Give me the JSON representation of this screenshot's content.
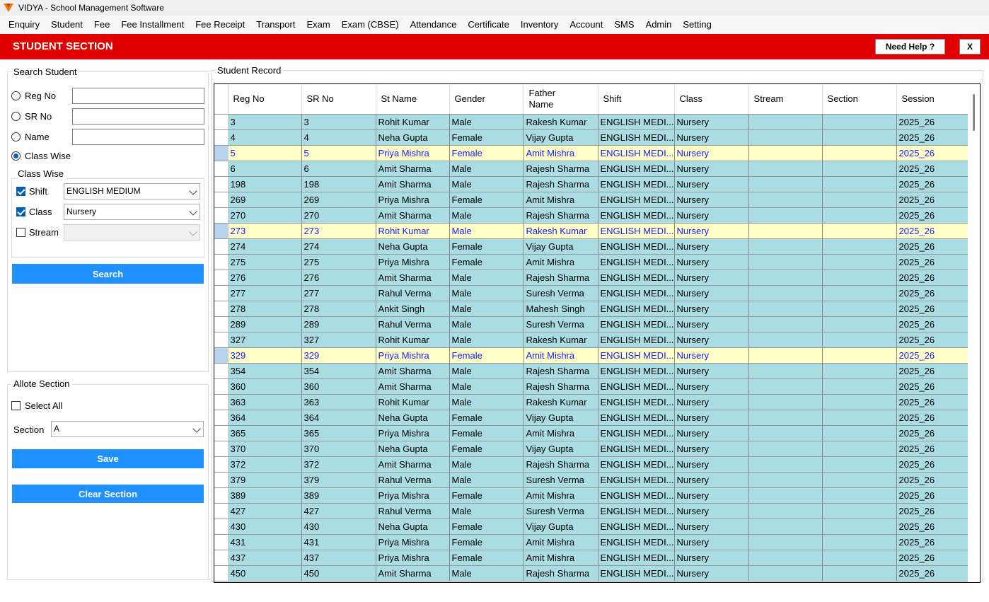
{
  "app": {
    "title": "VIDYA - School Management Software"
  },
  "menu": [
    "Enquiry",
    "Student",
    "Fee",
    "Fee Installment",
    "Fee Receipt",
    "Transport",
    "Exam",
    "Exam (CBSE)",
    "Attendance",
    "Certificate",
    "Inventory",
    "Account",
    "SMS",
    "Admin",
    "Setting"
  ],
  "header": {
    "title": "STUDENT SECTION",
    "help_label": "Need Help ?",
    "close_label": "X",
    "bar_color": "#e00000"
  },
  "search": {
    "group_label": "Search Student",
    "reg_no_label": "Reg No",
    "sr_no_label": "SR No",
    "name_label": "Name",
    "class_wise_label": "Class Wise",
    "selected_mode": "Class Wise",
    "class_wise_group_label": "Class Wise",
    "shift_label": "Shift",
    "shift_value": "ENGLISH MEDIUM",
    "shift_checked": true,
    "class_label": "Class",
    "class_value": "Nursery",
    "class_checked": true,
    "stream_label": "Stream",
    "stream_value": "",
    "stream_checked": false,
    "search_button": "Search"
  },
  "allot": {
    "group_label": "Allote Section",
    "select_all_label": "Select All",
    "section_label": "Section",
    "section_value": "A",
    "save_button": "Save",
    "clear_button": "Clear Section"
  },
  "record": {
    "group_label": "Student Record",
    "columns": [
      "Reg No",
      "SR No",
      "St Name",
      "Gender",
      "Father Name",
      "Shift",
      "Class",
      "Stream",
      "Section",
      "Session"
    ],
    "rows": [
      [
        "3",
        "3",
        "Rohit Kumar",
        "Male",
        "Rakesh Kumar",
        "ENGLISH MEDI...",
        "Nursery",
        "",
        "",
        "2025_26"
      ],
      [
        "4",
        "4",
        "Neha Gupta",
        "Female",
        "Vijay Gupta",
        "ENGLISH MEDI...",
        "Nursery",
        "",
        "",
        "2025_26"
      ],
      [
        "5",
        "5",
        "Priya Mishra",
        "Female",
        "Amit Mishra",
        "ENGLISH MEDI...",
        "Nursery",
        "",
        "",
        "2025_26"
      ],
      [
        "6",
        "6",
        "Amit Sharma",
        "Male",
        "Rajesh Sharma",
        "ENGLISH MEDI...",
        "Nursery",
        "",
        "",
        "2025_26"
      ],
      [
        "198",
        "198",
        "Amit Sharma",
        "Male",
        "Rajesh Sharma",
        "ENGLISH MEDI...",
        "Nursery",
        "",
        "",
        "2025_26"
      ],
      [
        "269",
        "269",
        "Priya Mishra",
        "Female",
        "Amit Mishra",
        "ENGLISH MEDI...",
        "Nursery",
        "",
        "",
        "2025_26"
      ],
      [
        "270",
        "270",
        "Amit Sharma",
        "Male",
        "Rajesh Sharma",
        "ENGLISH MEDI...",
        "Nursery",
        "",
        "",
        "2025_26"
      ],
      [
        "273",
        "273",
        "Rohit Kumar",
        "Male",
        "Rakesh Kumar",
        "ENGLISH MEDI...",
        "Nursery",
        "",
        "",
        "2025_26"
      ],
      [
        "274",
        "274",
        "Neha Gupta",
        "Female",
        "Vijay Gupta",
        "ENGLISH MEDI...",
        "Nursery",
        "",
        "",
        "2025_26"
      ],
      [
        "275",
        "275",
        "Priya Mishra",
        "Female",
        "Amit Mishra",
        "ENGLISH MEDI...",
        "Nursery",
        "",
        "",
        "2025_26"
      ],
      [
        "276",
        "276",
        "Amit Sharma",
        "Male",
        "Rajesh Sharma",
        "ENGLISH MEDI...",
        "Nursery",
        "",
        "",
        "2025_26"
      ],
      [
        "277",
        "277",
        "Rahul Verma",
        "Male",
        "Suresh Verma",
        "ENGLISH MEDI...",
        "Nursery",
        "",
        "",
        "2025_26"
      ],
      [
        "278",
        "278",
        "Ankit Singh",
        "Male",
        "Mahesh Singh",
        "ENGLISH MEDI...",
        "Nursery",
        "",
        "",
        "2025_26"
      ],
      [
        "289",
        "289",
        "Rahul Verma",
        "Male",
        "Suresh Verma",
        "ENGLISH MEDI...",
        "Nursery",
        "",
        "",
        "2025_26"
      ],
      [
        "327",
        "327",
        "Rohit Kumar",
        "Male",
        "Rakesh Kumar",
        "ENGLISH MEDI...",
        "Nursery",
        "",
        "",
        "2025_26"
      ],
      [
        "329",
        "329",
        "Priya Mishra",
        "Female",
        "Amit Mishra",
        "ENGLISH MEDI...",
        "Nursery",
        "",
        "",
        "2025_26"
      ],
      [
        "354",
        "354",
        "Amit Sharma",
        "Male",
        "Rajesh Sharma",
        "ENGLISH MEDI...",
        "Nursery",
        "",
        "",
        "2025_26"
      ],
      [
        "360",
        "360",
        "Amit Sharma",
        "Male",
        "Rajesh Sharma",
        "ENGLISH MEDI...",
        "Nursery",
        "",
        "",
        "2025_26"
      ],
      [
        "363",
        "363",
        "Rohit Kumar",
        "Male",
        "Rakesh Kumar",
        "ENGLISH MEDI...",
        "Nursery",
        "",
        "",
        "2025_26"
      ],
      [
        "364",
        "364",
        "Neha Gupta",
        "Female",
        "Vijay Gupta",
        "ENGLISH MEDI...",
        "Nursery",
        "",
        "",
        "2025_26"
      ],
      [
        "365",
        "365",
        "Priya Mishra",
        "Female",
        "Amit Mishra",
        "ENGLISH MEDI...",
        "Nursery",
        "",
        "",
        "2025_26"
      ],
      [
        "370",
        "370",
        "Neha Gupta",
        "Female",
        "Vijay Gupta",
        "ENGLISH MEDI...",
        "Nursery",
        "",
        "",
        "2025_26"
      ],
      [
        "372",
        "372",
        "Amit Sharma",
        "Male",
        "Rajesh Sharma",
        "ENGLISH MEDI...",
        "Nursery",
        "",
        "",
        "2025_26"
      ],
      [
        "379",
        "379",
        "Rahul Verma",
        "Male",
        "Suresh Verma",
        "ENGLISH MEDI...",
        "Nursery",
        "",
        "",
        "2025_26"
      ],
      [
        "389",
        "389",
        "Priya Mishra",
        "Female",
        "Amit Mishra",
        "ENGLISH MEDI...",
        "Nursery",
        "",
        "",
        "2025_26"
      ],
      [
        "427",
        "427",
        "Rahul Verma",
        "Male",
        "Suresh Verma",
        "ENGLISH MEDI...",
        "Nursery",
        "",
        "",
        "2025_26"
      ],
      [
        "430",
        "430",
        "Neha Gupta",
        "Female",
        "Vijay Gupta",
        "ENGLISH MEDI...",
        "Nursery",
        "",
        "",
        "2025_26"
      ],
      [
        "431",
        "431",
        "Priya Mishra",
        "Female",
        "Amit Mishra",
        "ENGLISH MEDI...",
        "Nursery",
        "",
        "",
        "2025_26"
      ],
      [
        "437",
        "437",
        "Priya Mishra",
        "Female",
        "Amit Mishra",
        "ENGLISH MEDI...",
        "Nursery",
        "",
        "",
        "2025_26"
      ],
      [
        "450",
        "450",
        "Amit Sharma",
        "Male",
        "Rajesh Sharma",
        "ENGLISH MEDI...",
        "Nursery",
        "",
        "",
        "2025_26"
      ]
    ],
    "highlighted_rows": [
      2,
      7,
      15
    ],
    "row_color": "#aadce3",
    "highlight_color": "#ffffc8"
  },
  "icons": {
    "app_logo": "vidya-logo-icon",
    "dropdown": "chevron-down-icon"
  }
}
